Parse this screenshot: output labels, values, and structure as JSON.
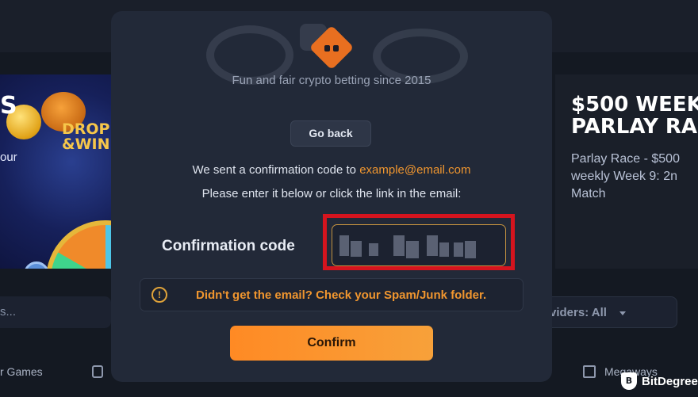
{
  "background": {
    "banner_left": {
      "partial_letter": "S",
      "promo_title": "DROP\n&WIN",
      "partial_text": "our"
    },
    "banner_right": {
      "title": "$500 WEEK\nPARLAY RAC",
      "description": "Parlay Race - $500\nweekly Week 9: 2n\nMatch"
    },
    "search_placeholder": "s...",
    "providers_label": "viders: All",
    "category_left": "r Games",
    "category_right": "Megaways"
  },
  "modal": {
    "tagline": "Fun and fair crypto betting since 2015",
    "go_back_label": "Go back",
    "sent_prefix": "We sent a confirmation code to ",
    "email": "example@email.com",
    "instruction": "Please enter it below or click the link in the email:",
    "code_label": "Confirmation code",
    "code_value": "",
    "warning_icon": "!",
    "warning_text": "Didn't get the email? Check your Spam/Junk folder.",
    "confirm_label": "Confirm"
  },
  "watermark": {
    "brand": "BitDegree",
    "icon": "B"
  },
  "colors": {
    "accent_orange": "#f0962f",
    "button_gradient_start": "#ff8a24",
    "highlight_red": "#d5141e",
    "modal_bg": "#222938"
  }
}
